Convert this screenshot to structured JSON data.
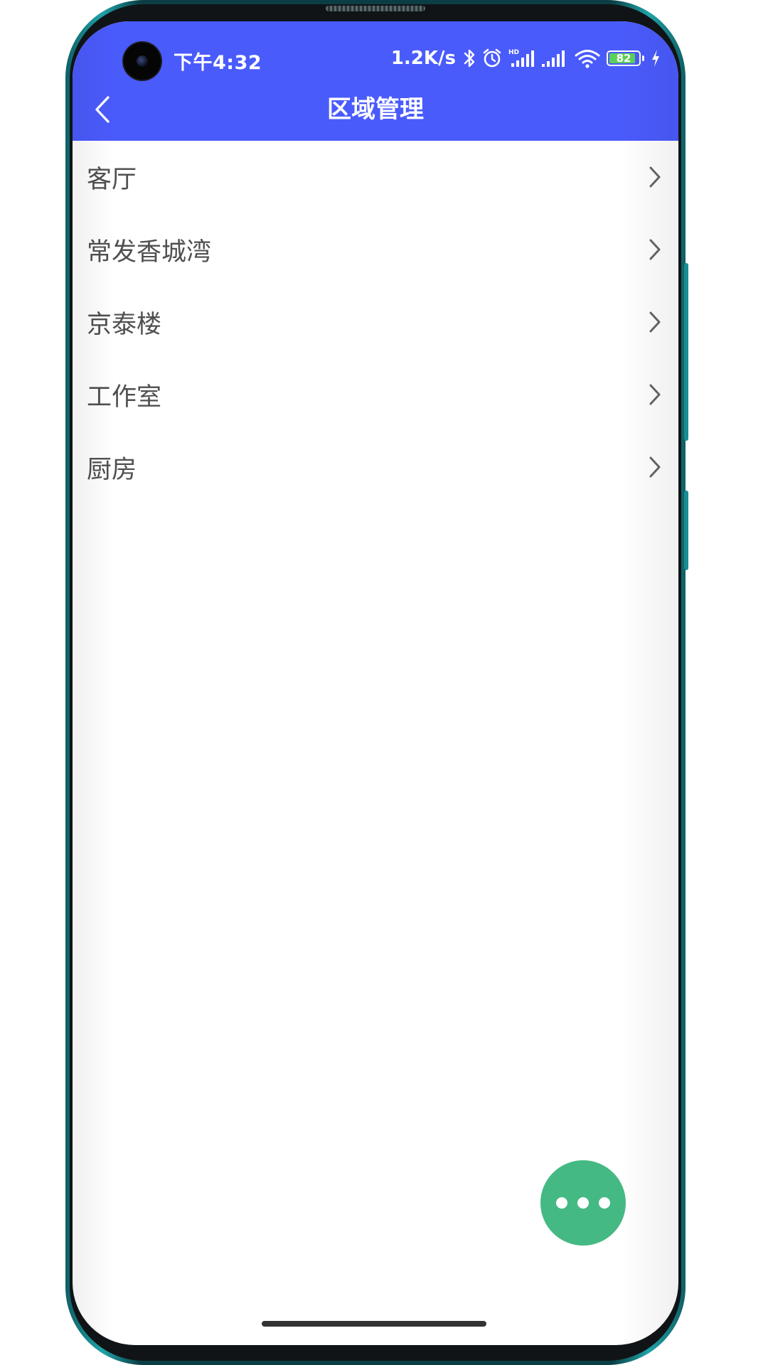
{
  "status_bar": {
    "time": "下午4:32",
    "net_speed": "1.2K/s",
    "battery_level": "82",
    "icons": [
      "bluetooth-icon",
      "alarm-icon",
      "hd-signal-icon",
      "signal-icon",
      "wifi-icon",
      "battery-icon",
      "charging-icon"
    ]
  },
  "header": {
    "title": "区域管理",
    "back_icon": "chevron-left-icon"
  },
  "areas": [
    {
      "label": "客厅"
    },
    {
      "label": "常发香城湾"
    },
    {
      "label": "京泰楼"
    },
    {
      "label": "工作室"
    },
    {
      "label": "厨房"
    }
  ],
  "fab": {
    "icon": "more-horizontal-icon"
  },
  "colors": {
    "app_bar": "#4a5bfc",
    "fab": "#45b983",
    "item_text": "#505050",
    "chevron": "#666666"
  }
}
